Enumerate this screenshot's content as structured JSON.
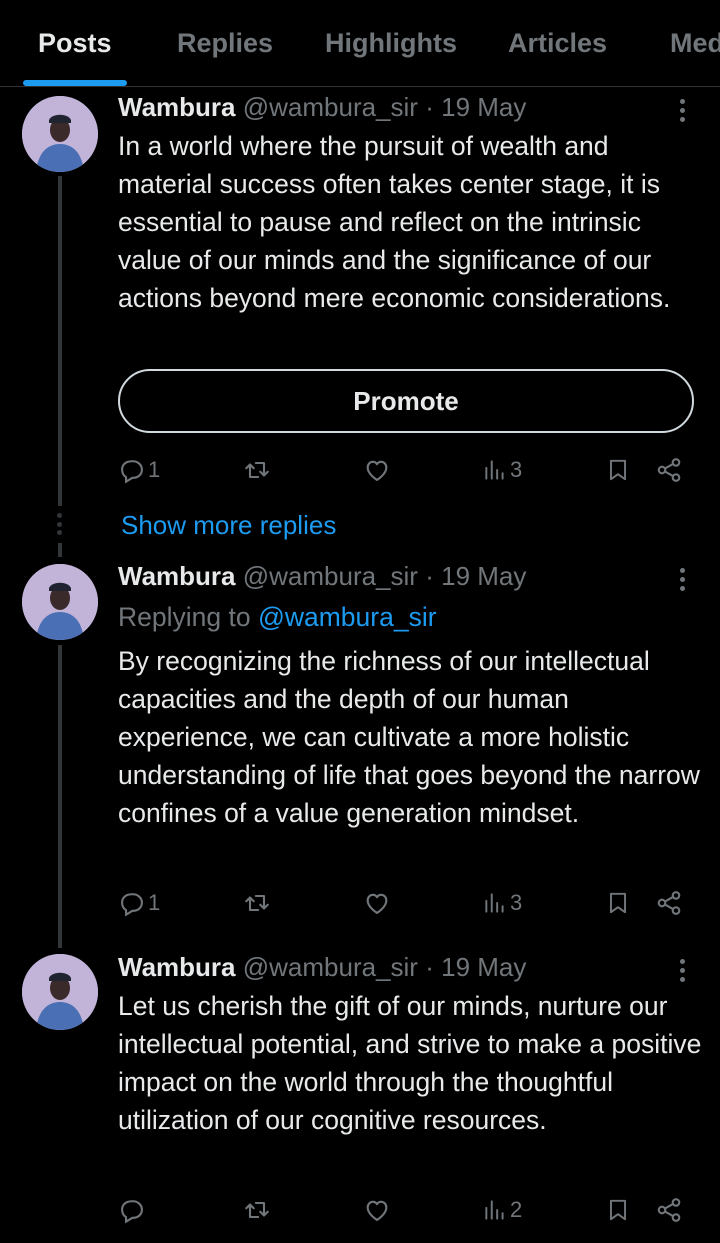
{
  "tabs": [
    "Posts",
    "Replies",
    "Highlights",
    "Articles",
    "Media"
  ],
  "active_tab": "Posts",
  "posts": [
    {
      "name": "Wambura",
      "handle": "@wambura_sir",
      "separator": "·",
      "date": "19 May",
      "text": "In a world where the pursuit of wealth and material success often takes center stage, it is essential to pause and reflect on the intrinsic value of our minds and the significance of our actions beyond mere economic considerations.",
      "promote_label": "Promote",
      "replies": "1",
      "views": "3"
    },
    {
      "name": "Wambura",
      "handle": "@wambura_sir",
      "separator": "·",
      "date": "19 May",
      "replying_prefix": "Replying to",
      "replying_handle": "@wambura_sir",
      "text": "By recognizing the richness of our intellectual capacities and the depth of our human experience, we can cultivate a more holistic understanding of life that goes beyond the narrow confines of a value generation mindset.",
      "replies": "1",
      "views": "3"
    },
    {
      "name": "Wambura",
      "handle": "@wambura_sir",
      "separator": "·",
      "date": "19 May",
      "text": "Let us cherish the gift of our minds, nurture our intellectual potential, and strive to make a positive impact on the world through the thoughtful utilization of our cognitive resources.",
      "replies": "",
      "views": "2"
    }
  ],
  "show_more_replies": "Show more replies",
  "icons": [
    "reply-icon",
    "repost-icon",
    "like-icon",
    "views-icon",
    "bookmark-icon",
    "share-icon",
    "more-options-icon"
  ],
  "colors": {
    "background": "#000000",
    "accent": "#1d9bf0",
    "muted": "#71767b",
    "text": "#e7e9ea"
  }
}
